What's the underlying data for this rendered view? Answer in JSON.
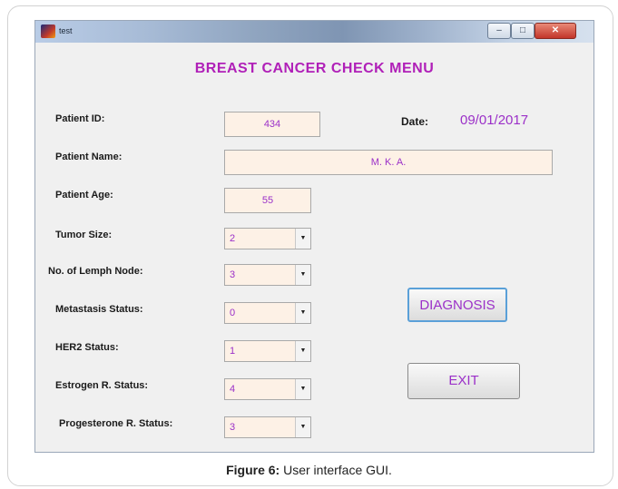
{
  "window": {
    "title": "test",
    "controls": {
      "minimize": "–",
      "maximize": "□",
      "close": "✕"
    }
  },
  "heading": "BREAST CANCER CHECK MENU",
  "fields": {
    "patient_id": {
      "label": "Patient ID:",
      "value": "434"
    },
    "patient_name": {
      "label": "Patient Name:",
      "value": "M. K. A."
    },
    "patient_age": {
      "label": "Patient Age:",
      "value": "55"
    }
  },
  "date": {
    "label": "Date:",
    "value": "09/01/2017"
  },
  "selects": [
    {
      "label": "Tumor Size:",
      "value": "2"
    },
    {
      "label": "No. of Lemph Node:",
      "value": "3"
    },
    {
      "label": "Metastasis Status:",
      "value": "0"
    },
    {
      "label": "HER2 Status:",
      "value": "1"
    },
    {
      "label": "Estrogen R. Status:",
      "value": "4"
    },
    {
      "label": "Progesterone R. Status:",
      "value": "3"
    }
  ],
  "buttons": {
    "diagnosis": "DIAGNOSIS",
    "exit": "EXIT"
  },
  "caption": {
    "prefix": "Figure 6:",
    "text": " User interface GUI."
  },
  "colors": {
    "heading": "#b020b8",
    "value_text": "#9b30c8",
    "field_bg": "#fdf1e6",
    "window_bg": "#f0f0f0"
  }
}
